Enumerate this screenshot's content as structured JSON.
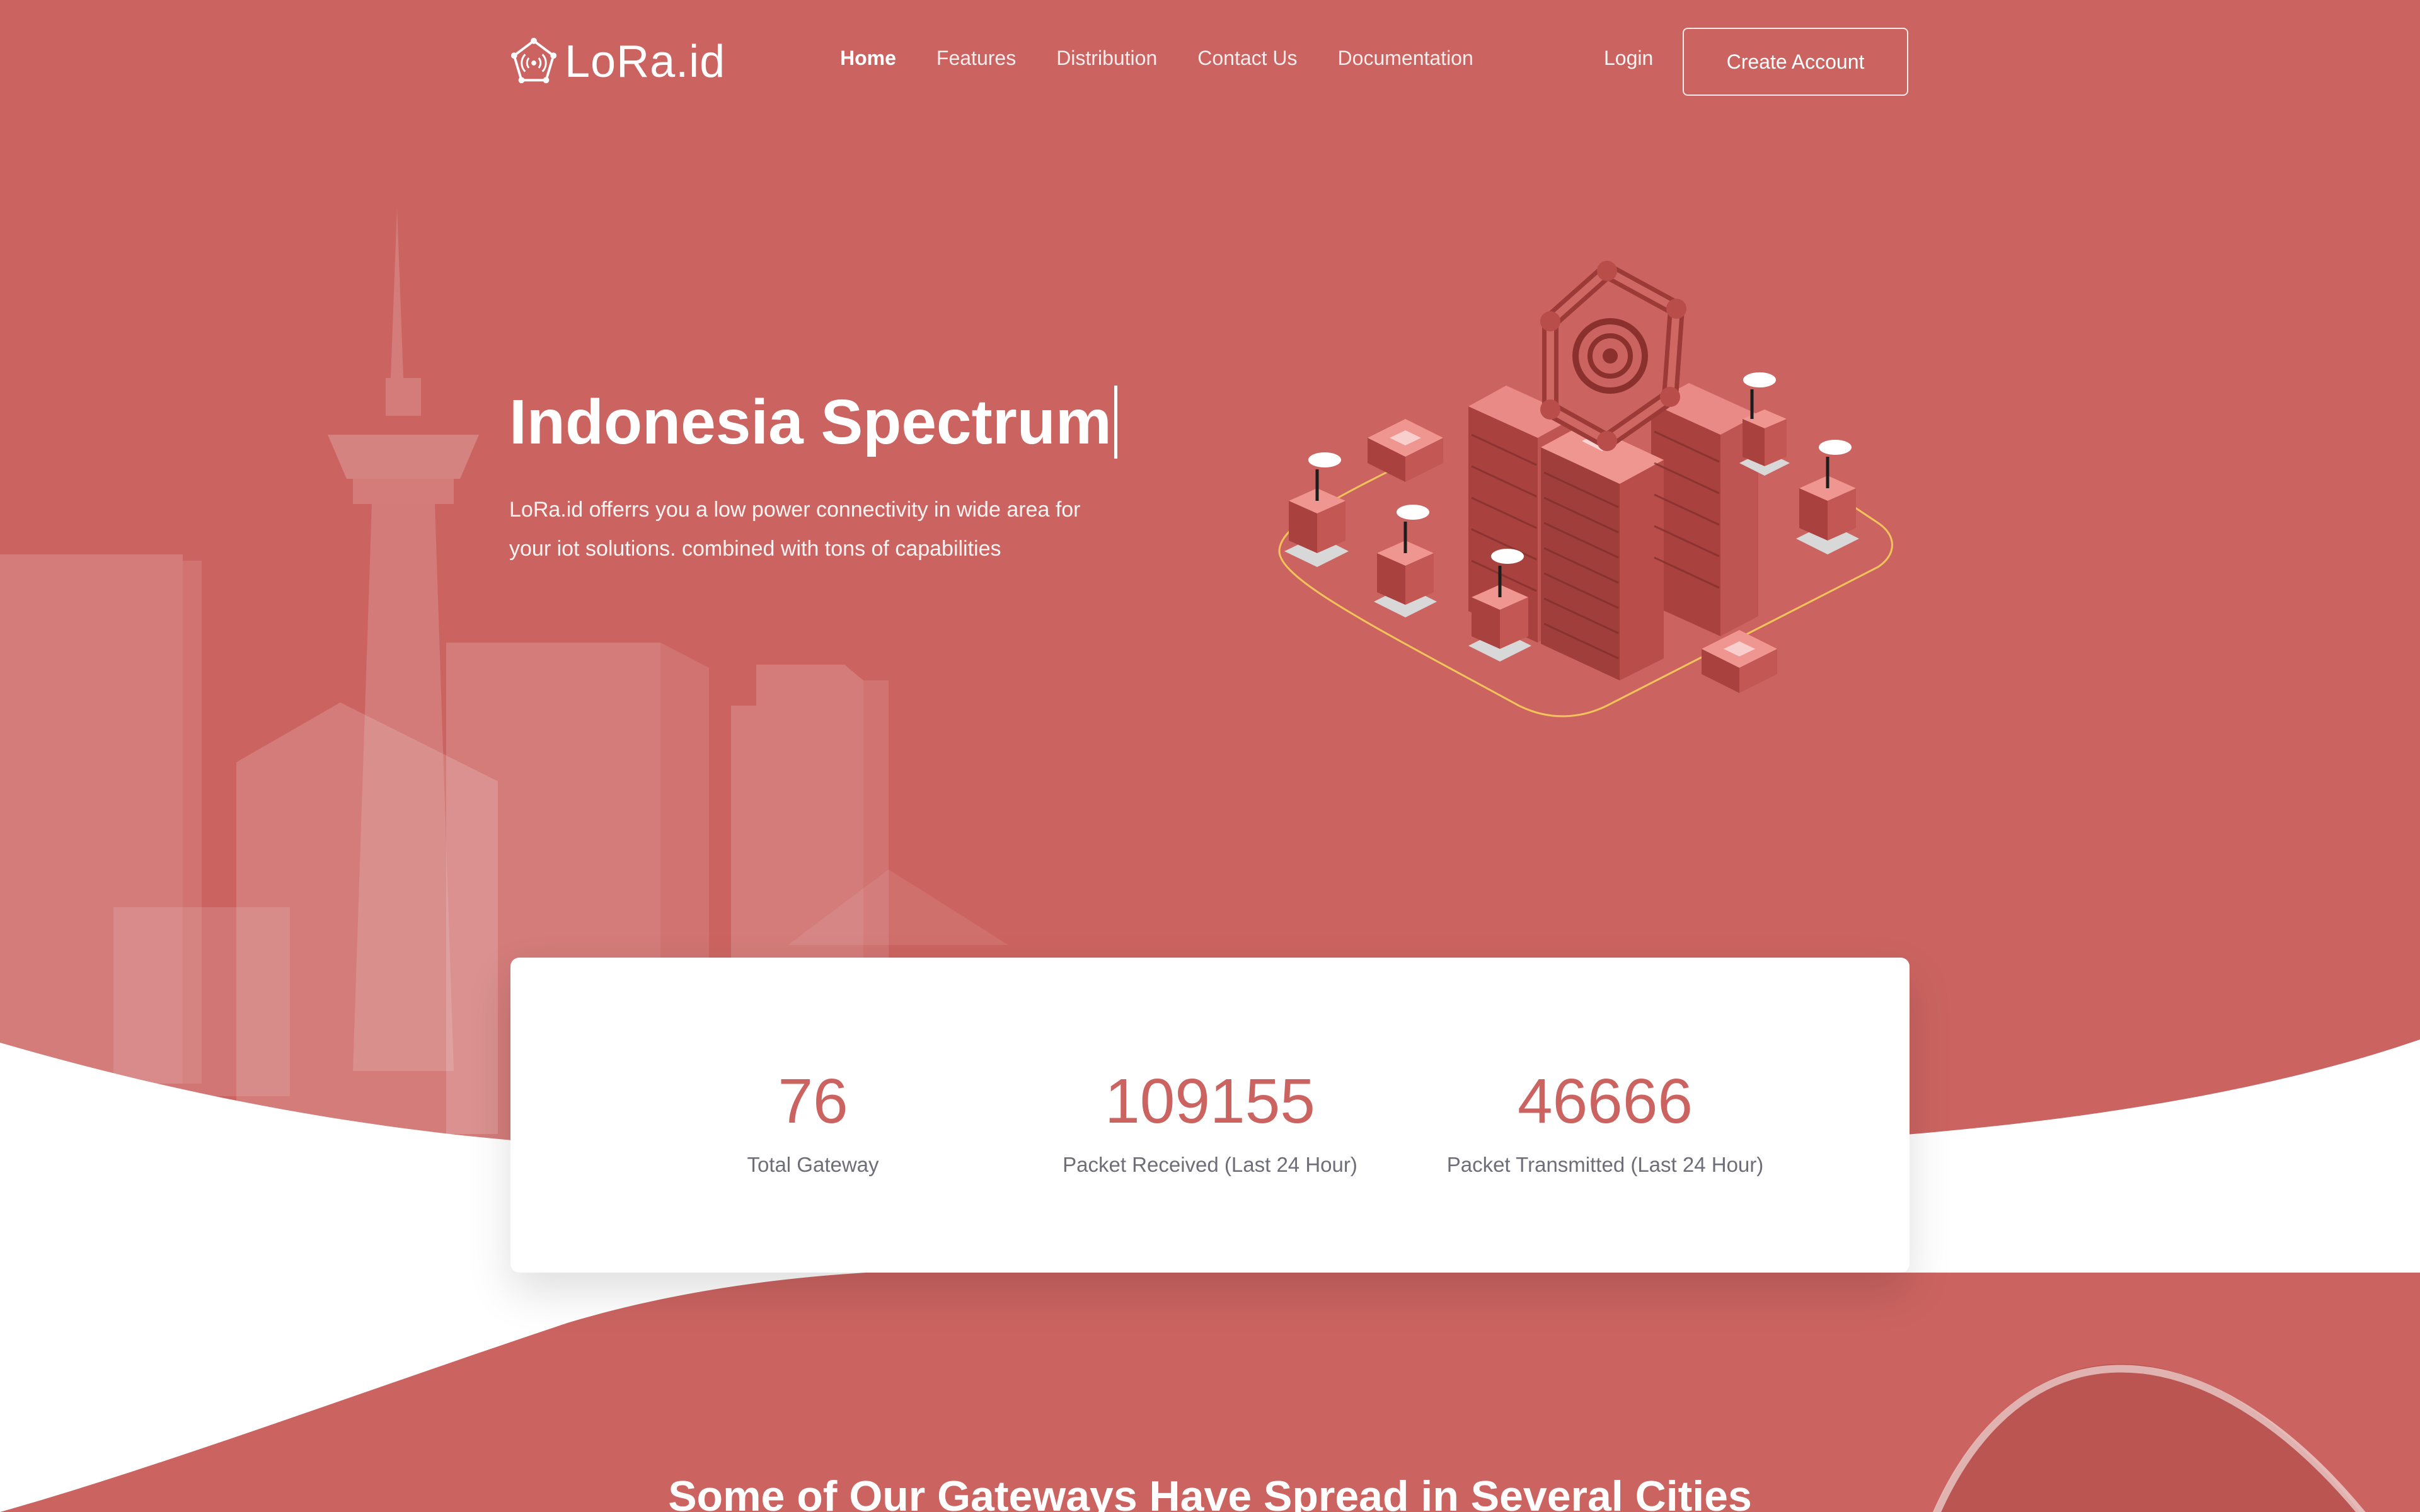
{
  "brand": {
    "name": "LoRa.id",
    "logo_icon": "signal-pentagon-icon"
  },
  "nav": {
    "items": [
      {
        "label": "Home",
        "active": true
      },
      {
        "label": "Features",
        "active": false
      },
      {
        "label": "Distribution",
        "active": false
      },
      {
        "label": "Contact Us",
        "active": false
      },
      {
        "label": "Documentation",
        "active": false
      }
    ],
    "login_label": "Login",
    "create_account_label": "Create Account"
  },
  "hero": {
    "title": "Indonesia Spectrum",
    "description": "LoRa.id offerrs you a low power connectivity in wide area for your iot solutions. combined with tons of capabilities",
    "illustration": "isometric-server-network-illustration"
  },
  "stats": [
    {
      "value": "76",
      "label": "Total Gateway"
    },
    {
      "value": "109155",
      "label": "Packet Received (Last 24 Hour)"
    },
    {
      "value": "46666",
      "label": "Packet Transmitted (Last 24 Hour)"
    }
  ],
  "section": {
    "heading": "Some of Our Gateways Have Spread in Several Cities"
  },
  "colors": {
    "primary": "#cb6461",
    "primary_dark": "#b4524f",
    "card_background": "#ffffff",
    "stat_label": "#6e6e78",
    "route_line": "#f2c35a"
  }
}
